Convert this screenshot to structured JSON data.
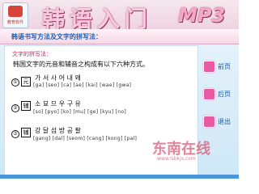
{
  "app": {
    "logo_text": "教育软件",
    "title": "韩语入门",
    "title_suffix": "MP3"
  },
  "banner": {
    "text": "韩语书写方法及文字的拼写法："
  },
  "content": {
    "subheading": "文字的拼写法：",
    "intro": "韩国文字的元音和辅音之构成有以下六种方式。",
    "rows": [
      {
        "number": "①",
        "box": "元",
        "letters": "가   서   사   어   내   왜",
        "roman": "[ga] [seo] [ca] [ae] [kai] [wae] [gwa]"
      },
      {
        "number": "②",
        "box": "辅",
        "letters": "소   묘   므   우   구   유",
        "roman": "[so] [pyo] [ko] [mu] [ge] [kyu] [no]"
      },
      {
        "number": "③",
        "box": "辅",
        "letters": "강   달   섬   방   공   팔",
        "roman": "[gang] [dal] [seom] [cang] [kong] [pal]"
      }
    ]
  },
  "nav": {
    "prev_label": "前页",
    "back_label": "后页",
    "exit_label": "退出"
  },
  "watermark": {
    "brand": "东南在线",
    "url": "www.lsbkjs.com"
  },
  "colors": {
    "accent_pink": "#e85aa2",
    "link_blue": "#1a5aa0",
    "title_pink": "#f7c9dd"
  }
}
